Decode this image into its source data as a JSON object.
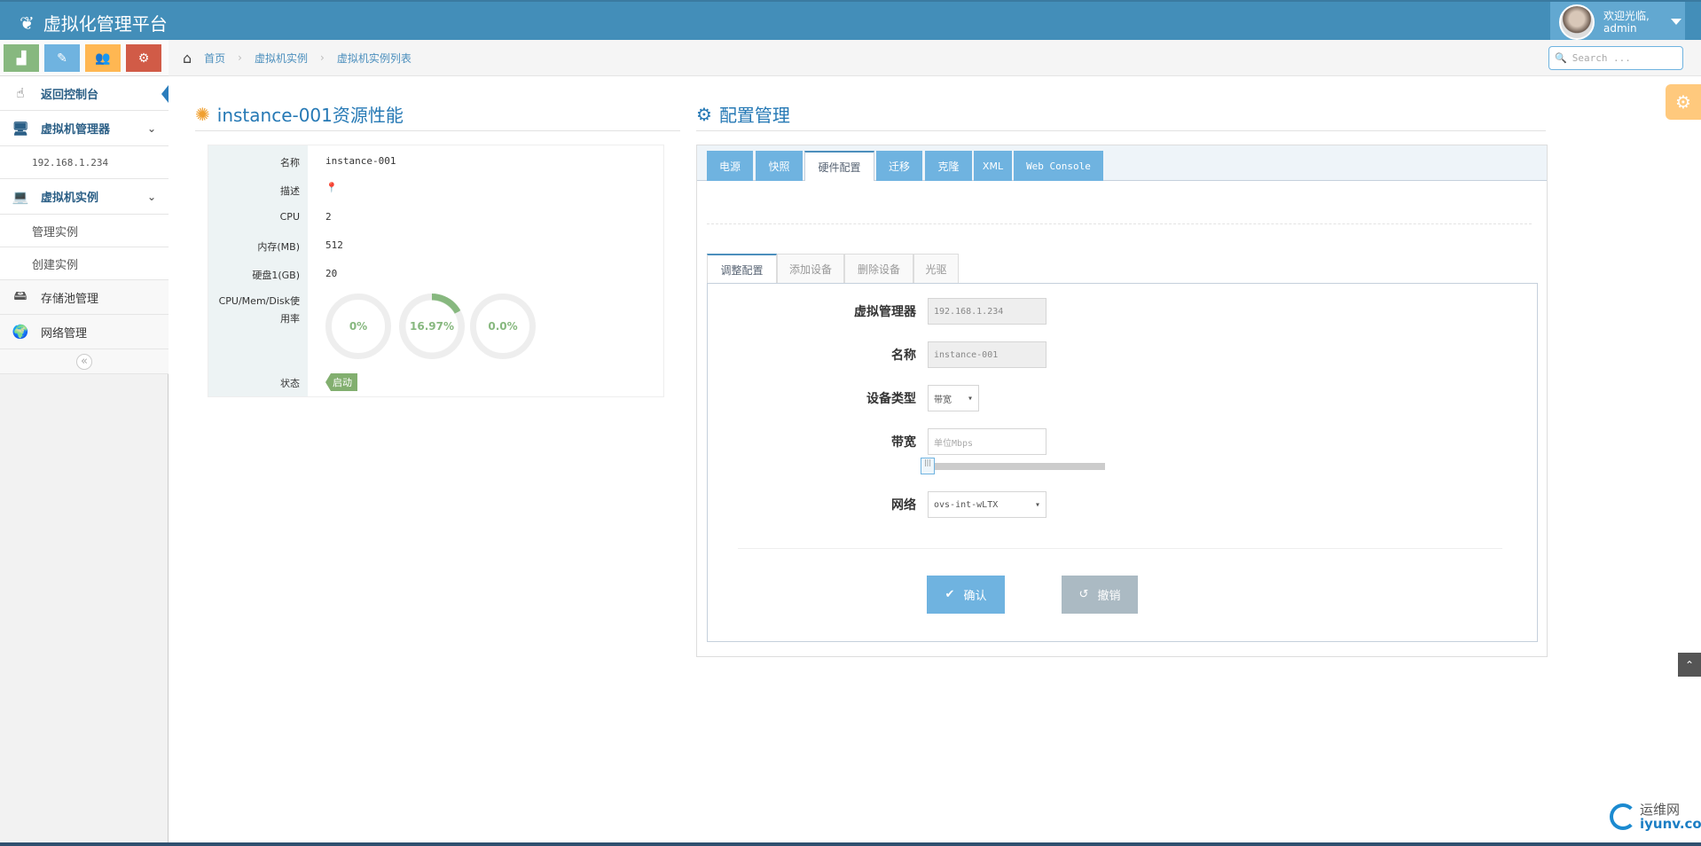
{
  "header": {
    "brand": "虚拟化管理平台",
    "welcome": "欢迎光临,",
    "user": "admin"
  },
  "shortcuts": [
    {
      "icon": "signal-icon",
      "color": "#87b87f"
    },
    {
      "icon": "pencil-icon",
      "color": "#6fb3e0"
    },
    {
      "icon": "users-icon",
      "color": "#ffb752"
    },
    {
      "icon": "cogs-icon",
      "color": "#d15b47"
    }
  ],
  "sidebar": {
    "items": [
      {
        "label": "返回控制台",
        "icon": "hand-icon"
      },
      {
        "label": "虚拟机管理器",
        "icon": "desktop-icon"
      },
      {
        "label": "192.168.1.234"
      },
      {
        "label": "虚拟机实例",
        "icon": "laptop-icon"
      },
      {
        "label": "管理实例"
      },
      {
        "label": "创建实例"
      },
      {
        "label": "存储池管理",
        "icon": "hdd-icon"
      },
      {
        "label": "网络管理",
        "icon": "globe-icon"
      }
    ],
    "collapse": "«"
  },
  "breadcrumb": [
    "首页",
    "虚拟机实例",
    "虚拟机实例列表"
  ],
  "search": {
    "placeholder": "Search ..."
  },
  "left": {
    "title": "instance-001资源性能",
    "rows": [
      {
        "label": "名称",
        "value": "instance-001"
      },
      {
        "label": "描述",
        "value": ""
      },
      {
        "label": "CPU",
        "value": "2"
      },
      {
        "label": "内存(MB)",
        "value": "512"
      },
      {
        "label": "硬盘1(GB)",
        "value": "20"
      }
    ],
    "usage_label": "CPU/Mem/Disk使用率",
    "usage": [
      {
        "text": "0%",
        "percent": 0
      },
      {
        "text": "16.97%",
        "percent": 16.97
      },
      {
        "text": "0.0%",
        "percent": 0
      }
    ],
    "status_label": "状态",
    "status": "启动"
  },
  "right": {
    "title": "配置管理",
    "tabs": [
      "电源",
      "快照",
      "硬件配置",
      "迁移",
      "克隆",
      "XML",
      "Web Console"
    ],
    "subtabs": [
      "调整配置",
      "添加设备",
      "删除设备",
      "光驱"
    ],
    "form": {
      "hypervisor_label": "虚拟管理器",
      "hypervisor": "192.168.1.234",
      "name_label": "名称",
      "name": "instance-001",
      "type_label": "设备类型",
      "type": "带宽",
      "bw_label": "带宽",
      "bw_placeholder": "单位Mbps",
      "bw_slider": 0,
      "net_label": "网络",
      "net": "ovs-int-wLTX"
    },
    "confirm": "确认",
    "cancel": "撤销"
  },
  "watermark": {
    "cn": "运维网",
    "en": "iyunv.com"
  }
}
